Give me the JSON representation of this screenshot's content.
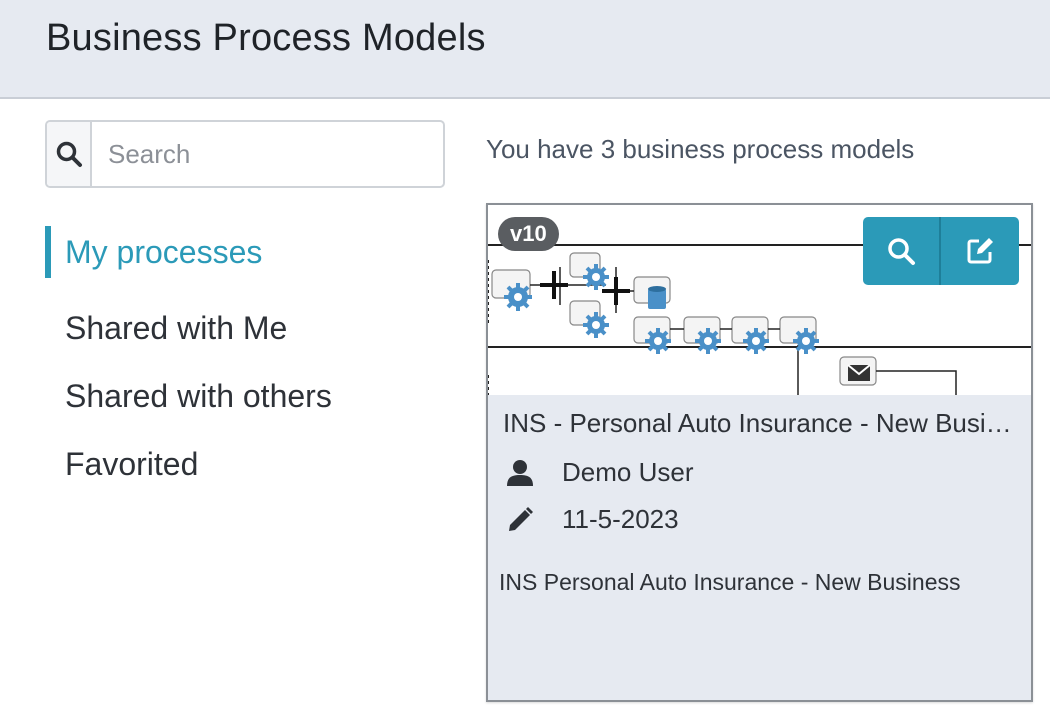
{
  "header": {
    "title": "Business Process Models"
  },
  "search": {
    "placeholder": "Search"
  },
  "nav": {
    "items": [
      {
        "label": "My processes",
        "active": true
      },
      {
        "label": "Shared with Me",
        "active": false
      },
      {
        "label": "Shared with others",
        "active": false
      },
      {
        "label": "Favorited",
        "active": false
      }
    ]
  },
  "summary": {
    "text": "You have 3 business process models"
  },
  "card": {
    "version": "v10",
    "title": "INS - Personal Auto Insurance - New Business",
    "owner": "Demo User",
    "modified": "11-5-2023",
    "description": "INS Personal Auto Insurance - New Business"
  },
  "colors": {
    "accent": "#2b9ab8",
    "header_bg": "#e6eaf1",
    "card_bg": "#e6eaf1"
  }
}
